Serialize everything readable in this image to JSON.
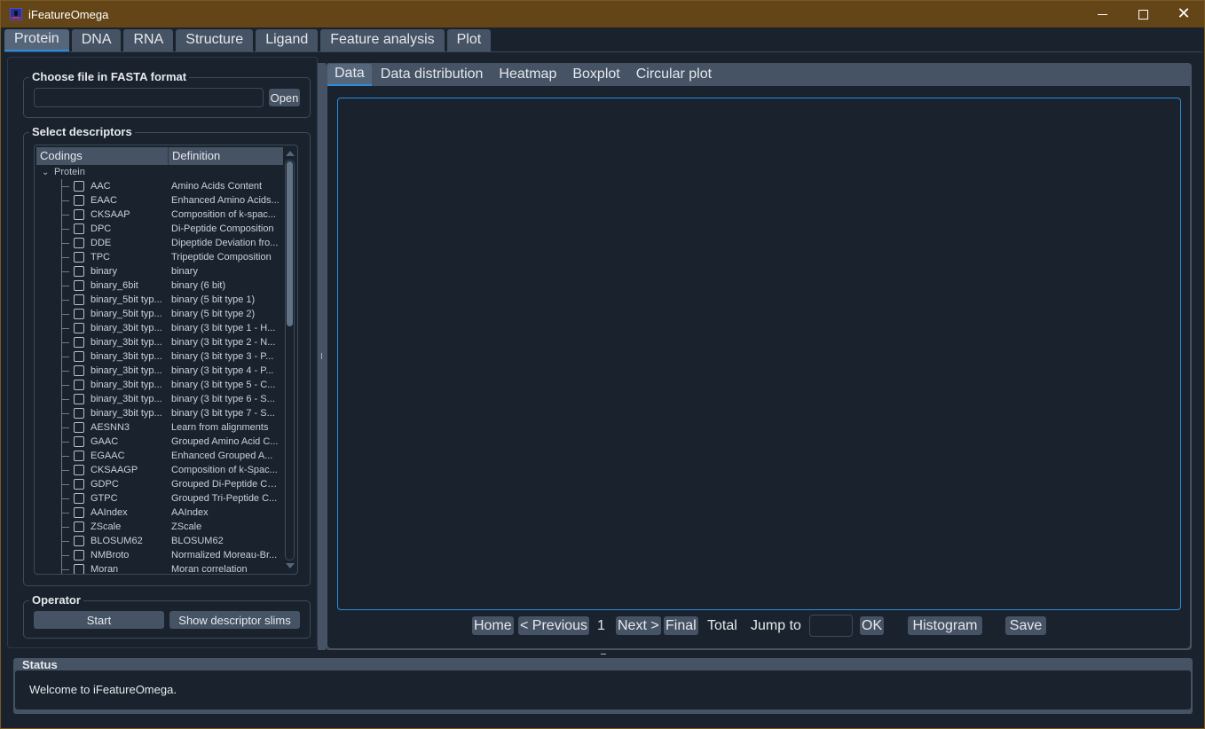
{
  "window": {
    "title": "iFeatureOmega",
    "controls": {
      "minimize": "minimize",
      "maximize": "maximize",
      "close": "close"
    }
  },
  "top_tabs": [
    {
      "label": "Protein",
      "active": true
    },
    {
      "label": "DNA",
      "active": false
    },
    {
      "label": "RNA",
      "active": false
    },
    {
      "label": "Structure",
      "active": false
    },
    {
      "label": "Ligand",
      "active": false
    },
    {
      "label": "Feature analysis",
      "active": false
    },
    {
      "label": "Plot",
      "active": false
    }
  ],
  "left_panel": {
    "fasta_group": {
      "title": "Choose file in FASTA format",
      "file_value": "",
      "file_placeholder": "",
      "open_label": "Open"
    },
    "descriptors_group": {
      "title": "Select descriptors",
      "columns": [
        "Codings",
        "Definition"
      ],
      "root": {
        "label": "Protein",
        "expanded": true
      },
      "items": [
        {
          "code": "AAC",
          "definition": "Amino Acids Content",
          "checked": false
        },
        {
          "code": "EAAC",
          "definition": "Enhanced Amino Acids...",
          "checked": false
        },
        {
          "code": "CKSAAP",
          "definition": "Composition of k-spac...",
          "checked": false
        },
        {
          "code": "DPC",
          "definition": "Di-Peptide Composition",
          "checked": false
        },
        {
          "code": "DDE",
          "definition": "Dipeptide Deviation fro...",
          "checked": false
        },
        {
          "code": "TPC",
          "definition": "Tripeptide Composition",
          "checked": false
        },
        {
          "code": "binary",
          "definition": "binary",
          "checked": false
        },
        {
          "code": "binary_6bit",
          "definition": "binary (6 bit)",
          "checked": false
        },
        {
          "code": "binary_5bit typ...",
          "definition": "binary (5 bit type 1)",
          "checked": false
        },
        {
          "code": "binary_5bit typ...",
          "definition": "binary (5 bit type 2)",
          "checked": false
        },
        {
          "code": "binary_3bit typ...",
          "definition": "binary (3 bit type 1 - H...",
          "checked": false
        },
        {
          "code": "binary_3bit typ...",
          "definition": "binary (3 bit type 2 - N...",
          "checked": false
        },
        {
          "code": "binary_3bit typ...",
          "definition": "binary (3 bit type 3 - P...",
          "checked": false
        },
        {
          "code": "binary_3bit typ...",
          "definition": "binary (3 bit type 4 - P...",
          "checked": false
        },
        {
          "code": "binary_3bit typ...",
          "definition": "binary (3 bit type 5 - C...",
          "checked": false
        },
        {
          "code": "binary_3bit typ...",
          "definition": "binary (3 bit type 6 - S...",
          "checked": false
        },
        {
          "code": "binary_3bit typ...",
          "definition": "binary (3 bit type 7 - S...",
          "checked": false
        },
        {
          "code": "AESNN3",
          "definition": "Learn from alignments",
          "checked": false
        },
        {
          "code": "GAAC",
          "definition": "Grouped Amino Acid C...",
          "checked": false
        },
        {
          "code": "EGAAC",
          "definition": "Enhanced Grouped A...",
          "checked": false
        },
        {
          "code": "CKSAAGP",
          "definition": "Composition of k-Spac...",
          "checked": false
        },
        {
          "code": "GDPC",
          "definition": "Grouped Di-Peptide Co...",
          "checked": false
        },
        {
          "code": "GTPC",
          "definition": "Grouped Tri-Peptide C...",
          "checked": false
        },
        {
          "code": "AAIndex",
          "definition": "AAIndex",
          "checked": false
        },
        {
          "code": "ZScale",
          "definition": "ZScale",
          "checked": false
        },
        {
          "code": "BLOSUM62",
          "definition": "BLOSUM62",
          "checked": false
        },
        {
          "code": "NMBroto",
          "definition": "Normalized Moreau-Br...",
          "checked": false
        },
        {
          "code": "Moran",
          "definition": "Moran correlation",
          "checked": false
        }
      ]
    },
    "operator_group": {
      "title": "Operator",
      "start_label": "Start",
      "slims_label": "Show descriptor slims"
    }
  },
  "right_panel": {
    "tabs": [
      {
        "label": "Data",
        "active": true
      },
      {
        "label": "Data distribution",
        "active": false
      },
      {
        "label": "Heatmap",
        "active": false
      },
      {
        "label": "Boxplot",
        "active": false
      },
      {
        "label": "Circular plot",
        "active": false
      }
    ],
    "pager": {
      "home_label": "Home",
      "previous_label": "< Previous",
      "current_page": "1",
      "next_label": "Next >",
      "final_label": "Final",
      "total_label": "Total",
      "jump_label": "Jump to",
      "jump_value": "",
      "ok_label": "OK",
      "histogram_label": "Histogram",
      "save_label": "Save"
    }
  },
  "status": {
    "title": "Status",
    "message": "Welcome to iFeatureOmega."
  }
}
